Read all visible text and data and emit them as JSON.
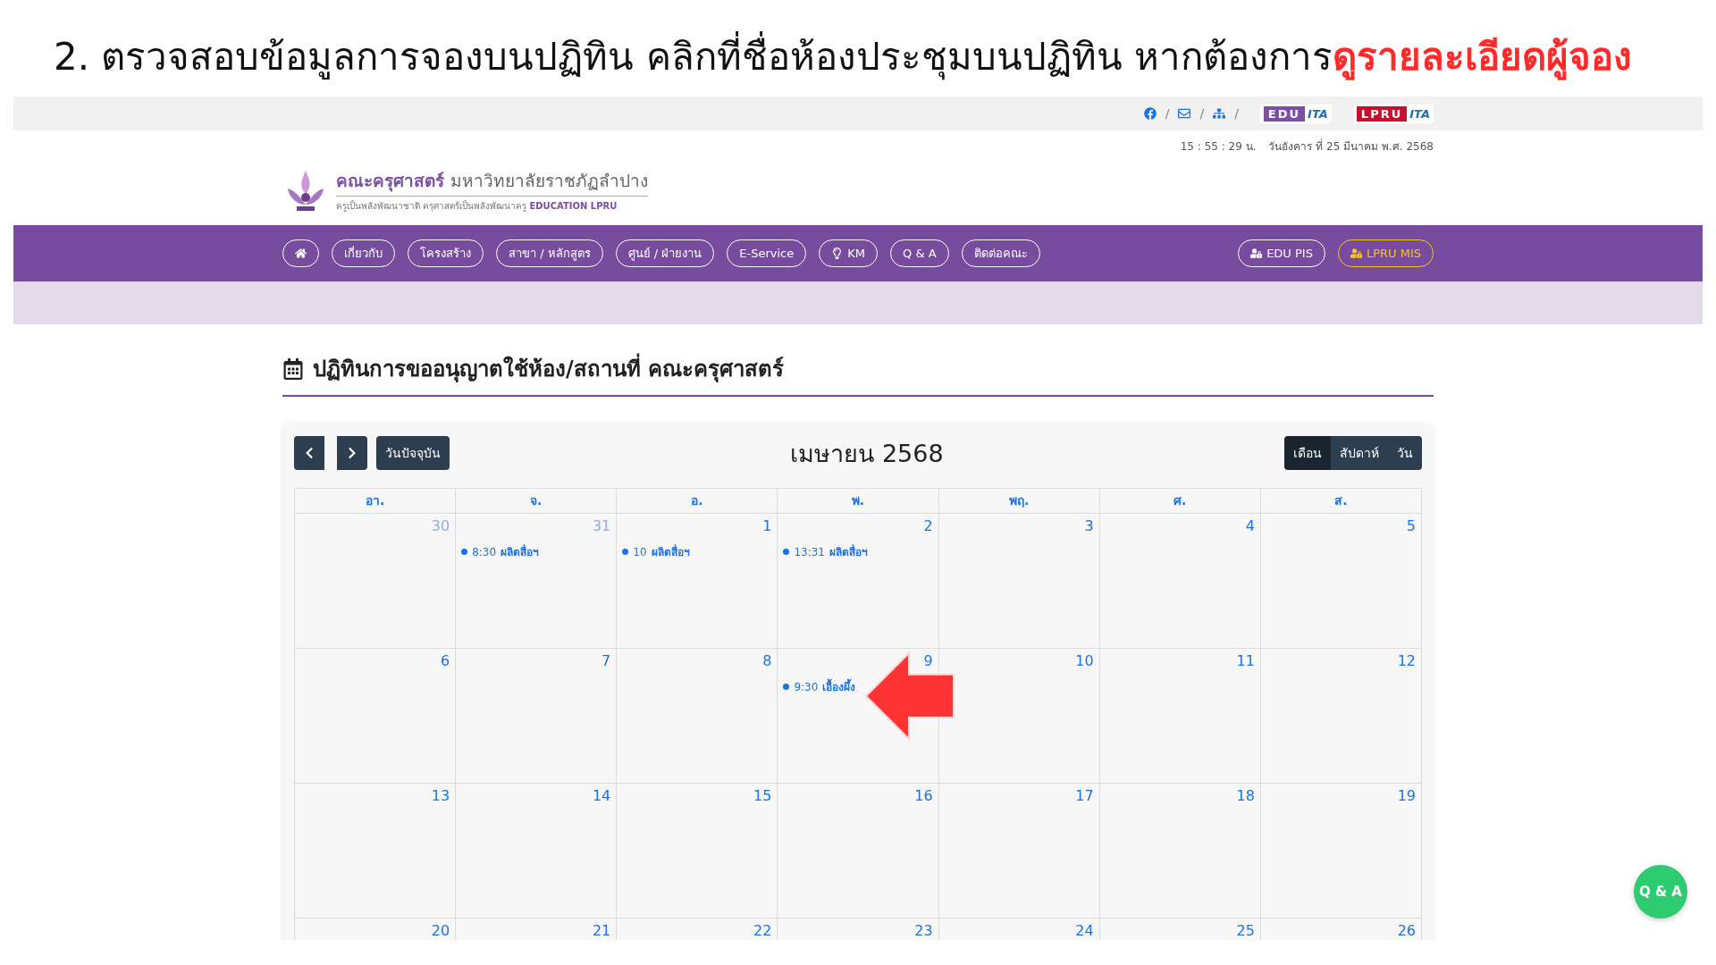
{
  "instruction": {
    "text": "2. ตรวจสอบข้อมูลการจองบนปฏิทิน คลิกที่ชื่อห้องประชุมบนปฏิทิน หากต้องการ",
    "emphasis": "ดูรายละเอียดผู้จอง"
  },
  "top_bar": {
    "separator": "/",
    "links": [
      {
        "kind": "facebook"
      },
      {
        "kind": "mail"
      },
      {
        "kind": "sitemap"
      }
    ],
    "badges": [
      {
        "left": "EDU",
        "right": "ITA",
        "color": "#7b4fa6"
      },
      {
        "left": "LPRU",
        "right": "ITA",
        "color": "#c8102e"
      }
    ]
  },
  "clock": {
    "time": "15 : 55 : 29 น.",
    "date": "วันอังคาร ที่ 25 มีนาคม พ.ศ. 2568"
  },
  "logo": {
    "name": "คณะครุศาสตร์",
    "university": "มหาวิทยาลัยราชภัฏลำปาง",
    "tagline": "ครูเป็นพลังพัฒนาชาติ ครุศาสตร์เป็นพลังพัฒนาครู",
    "tag_en": "EDUCATION LPRU"
  },
  "nav": {
    "items": [
      {
        "kind": "home"
      },
      {
        "kind": "text",
        "label": "เกี่ยวกับ"
      },
      {
        "kind": "text",
        "label": "โครงสร้าง"
      },
      {
        "kind": "text",
        "label": "สาขา / หลักสูตร"
      },
      {
        "kind": "text",
        "label": "ศูนย์ / ฝ่ายงาน"
      },
      {
        "kind": "text",
        "label": "E-Service"
      },
      {
        "kind": "bulb",
        "label": "KM"
      },
      {
        "kind": "text",
        "label": "Q & A"
      },
      {
        "kind": "text",
        "label": "ติดต่อคณะ"
      }
    ],
    "systems": [
      {
        "label": "EDU PIS",
        "color": "#ffffff"
      },
      {
        "label": "LPRU MIS",
        "color": "#f5c518"
      }
    ]
  },
  "page_title": "ปฏิทินการขออนุญาตใช้ห้อง/สถานที่ คณะครุศาสตร์",
  "calendar": {
    "today_button": "วันปัจจุบัน",
    "title": "เมษายน 2568",
    "views": [
      {
        "label": "เดือน",
        "selected": true
      },
      {
        "label": "สัปดาห์",
        "selected": false
      },
      {
        "label": "วัน",
        "selected": false
      }
    ],
    "weekdays": [
      "อา.",
      "จ.",
      "อ.",
      "พ.",
      "พฤ.",
      "ศ.",
      "ส."
    ],
    "weeks": [
      [
        {
          "date": "30",
          "other_month": true
        },
        {
          "date": "31",
          "other_month": true,
          "events": [
            {
              "time": "8:30",
              "title": "ผลิตสื่อฯ"
            }
          ]
        },
        {
          "date": "1",
          "other_month": false,
          "events": [
            {
              "time": "10",
              "title": "ผลิตสื่อฯ"
            }
          ]
        },
        {
          "date": "2",
          "other_month": false,
          "events": [
            {
              "time": "13:31",
              "title": "ผลิตสื่อฯ"
            }
          ]
        },
        {
          "date": "3",
          "other_month": false
        },
        {
          "date": "4",
          "other_month": false
        },
        {
          "date": "5",
          "other_month": false
        }
      ],
      [
        {
          "date": "6",
          "other_month": false
        },
        {
          "date": "7",
          "other_month": false
        },
        {
          "date": "8",
          "other_month": false
        },
        {
          "date": "9",
          "other_month": false,
          "events": [
            {
              "time": "9:30",
              "title": "เอื้องผึ้ง"
            }
          ]
        },
        {
          "date": "10",
          "other_month": false
        },
        {
          "date": "11",
          "other_month": false
        },
        {
          "date": "12",
          "other_month": false
        }
      ],
      [
        {
          "date": "13",
          "other_month": false
        },
        {
          "date": "14",
          "other_month": false
        },
        {
          "date": "15",
          "other_month": false
        },
        {
          "date": "16",
          "other_month": false
        },
        {
          "date": "17",
          "other_month": false
        },
        {
          "date": "18",
          "other_month": false
        },
        {
          "date": "19",
          "other_month": false
        }
      ],
      [
        {
          "date": "20",
          "other_month": false
        },
        {
          "date": "21",
          "other_month": false
        },
        {
          "date": "22",
          "other_month": false
        },
        {
          "date": "23",
          "other_month": false
        },
        {
          "date": "24",
          "other_month": false
        },
        {
          "date": "25",
          "other_month": false
        },
        {
          "date": "26",
          "other_month": false
        }
      ]
    ]
  },
  "floating_button": "Q & A"
}
